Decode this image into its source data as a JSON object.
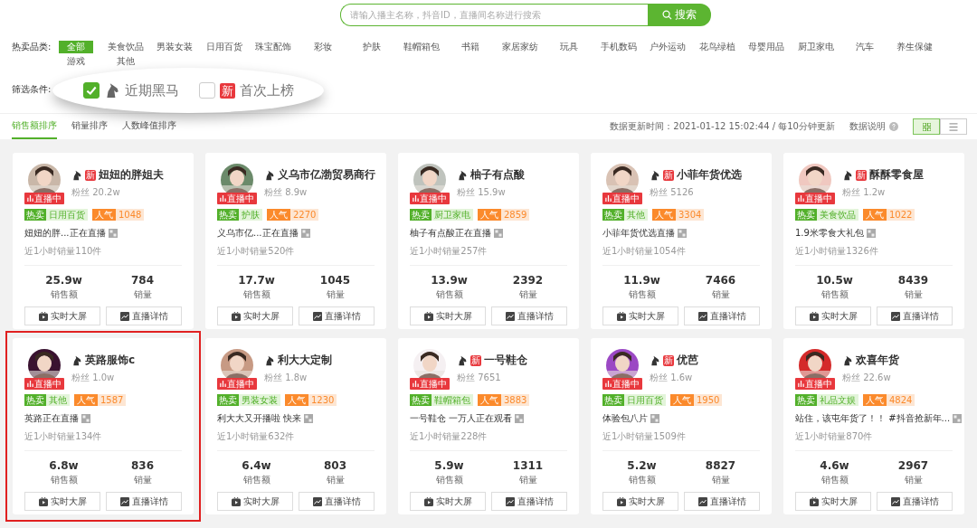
{
  "search": {
    "placeholder": "请输入播主名称，抖音ID，直播间名称进行搜索",
    "button": "搜索"
  },
  "categories": {
    "label": "热卖品类:",
    "items": [
      {
        "label": "全部",
        "selected": true
      },
      {
        "label": "美食饮品",
        "selected": false
      },
      {
        "label": "男装女装",
        "selected": false
      },
      {
        "label": "日用百货",
        "selected": false
      },
      {
        "label": "珠宝配饰",
        "selected": false
      },
      {
        "label": "彩妆",
        "selected": false
      },
      {
        "label": "护肤",
        "selected": false
      },
      {
        "label": "鞋帽箱包",
        "selected": false
      },
      {
        "label": "书籍",
        "selected": false
      },
      {
        "label": "家居家纺",
        "selected": false
      },
      {
        "label": "玩具",
        "selected": false
      },
      {
        "label": "手机数码",
        "selected": false
      },
      {
        "label": "户外运动",
        "selected": false
      },
      {
        "label": "花鸟绿植",
        "selected": false
      },
      {
        "label": "母婴用品",
        "selected": false
      },
      {
        "label": "厨卫家电",
        "selected": false
      },
      {
        "label": "汽车",
        "selected": false
      },
      {
        "label": "养生保健",
        "selected": false
      },
      {
        "label": "游戏",
        "selected": false
      },
      {
        "label": "其他",
        "selected": false
      }
    ]
  },
  "filters": {
    "label": "筛选条件:",
    "options": [
      {
        "kind": "dark_horse",
        "label": "近期黑马",
        "checked": true
      },
      {
        "kind": "new",
        "badge": "新",
        "label": "首次上榜",
        "checked": false
      }
    ]
  },
  "sort_tabs": [
    {
      "label": "销售额排序",
      "selected": true
    },
    {
      "label": "销量排序",
      "selected": false
    },
    {
      "label": "人数峰值排序",
      "selected": false
    }
  ],
  "update_time": "数据更新时间：2021-01-12 15:02:44 / 每10分钟更新",
  "help_label": "数据说明",
  "view_toggle": [
    {
      "kind": "grid",
      "selected": true
    },
    {
      "kind": "list",
      "selected": false
    }
  ],
  "cards": [
    {
      "name": "妞妞的胖姐夫",
      "new_badge": "新",
      "fans": "粉丝 20.2w",
      "live": "直播中",
      "hot": "热卖",
      "category": "日用百货",
      "pop_label": "人气",
      "popularity": "1048",
      "title": "妞妞的胖...正在直播",
      "recent": "近1小时销量110件",
      "amount": "25.9w",
      "amount_label": "销售额",
      "count": "784",
      "count_label": "销量",
      "buttons": [
        "实时大屏",
        "直播详情"
      ],
      "highlighted": false
    },
    {
      "name": "义乌市亿渤贸易商行",
      "fans": "粉丝 8.9w",
      "live": "直播中",
      "hot": "热卖",
      "category": "护肤",
      "pop_label": "人气",
      "popularity": "2270",
      "title": "义乌市亿...正在直播",
      "recent": "近1小时销量520件",
      "amount": "17.7w",
      "amount_label": "销售额",
      "count": "1045",
      "count_label": "销量",
      "buttons": [
        "实时大屏",
        "直播详情"
      ],
      "highlighted": false
    },
    {
      "name": "柚子有点酸",
      "fans": "粉丝 15.9w",
      "live": "直播中",
      "hot": "热卖",
      "category": "厨卫家电",
      "pop_label": "人气",
      "popularity": "2859",
      "title": "柚子有点酸正在直播",
      "recent": "近1小时销量257件",
      "amount": "13.9w",
      "amount_label": "销售额",
      "count": "2392",
      "count_label": "销量",
      "buttons": [
        "实时大屏",
        "直播详情"
      ],
      "highlighted": false
    },
    {
      "name": "小菲年货优选",
      "new_badge": "新",
      "fans": "粉丝 5126",
      "live": "直播中",
      "hot": "热卖",
      "category": "其他",
      "pop_label": "人气",
      "popularity": "3304",
      "title": "小菲年货优选直播",
      "recent": "近1小时销量1054件",
      "amount": "11.9w",
      "amount_label": "销售额",
      "count": "7466",
      "count_label": "销量",
      "buttons": [
        "实时大屏",
        "直播详情"
      ],
      "highlighted": false
    },
    {
      "name": "酥酥零食屋",
      "new_badge": "新",
      "fans": "粉丝 1.2w",
      "live": "直播中",
      "hot": "热卖",
      "category": "美食饮品",
      "pop_label": "人气",
      "popularity": "1022",
      "title": "1.9米零食大礼包",
      "recent": "近1小时销量1326件",
      "amount": "10.5w",
      "amount_label": "销售额",
      "count": "8439",
      "count_label": "销量",
      "buttons": [
        "实时大屏",
        "直播详情"
      ],
      "highlighted": false
    },
    {
      "name": "英路服饰c",
      "fans": "粉丝 1.0w",
      "live": "直播中",
      "hot": "热卖",
      "category": "其他",
      "pop_label": "人气",
      "popularity": "1587",
      "title": "英路正在直播",
      "recent": "近1小时销量134件",
      "amount": "6.8w",
      "amount_label": "销售额",
      "count": "836",
      "count_label": "销量",
      "buttons": [
        "实时大屏",
        "直播详情"
      ],
      "highlighted": true
    },
    {
      "name": "利大大定制",
      "fans": "粉丝 1.8w",
      "live": "直播中",
      "hot": "热卖",
      "category": "男装女装",
      "pop_label": "人气",
      "popularity": "1230",
      "title": "利大大又开播啦 快来",
      "recent": "近1小时销量632件",
      "amount": "6.4w",
      "amount_label": "销售额",
      "count": "803",
      "count_label": "销量",
      "buttons": [
        "实时大屏",
        "直播详情"
      ],
      "highlighted": false
    },
    {
      "name": "一号鞋仓",
      "new_badge": "新",
      "fans": "粉丝 7651",
      "live": "直播中",
      "hot": "热卖",
      "category": "鞋帽箱包",
      "pop_label": "人气",
      "popularity": "3883",
      "title": "一号鞋仓 一万人正在观看",
      "recent": "近1小时销量228件",
      "amount": "5.9w",
      "amount_label": "销售额",
      "count": "1311",
      "count_label": "销量",
      "buttons": [
        "实时大屏",
        "直播详情"
      ],
      "highlighted": false
    },
    {
      "name": "优芭",
      "new_badge": "新",
      "fans": "粉丝 1.6w",
      "live": "直播中",
      "hot": "热卖",
      "category": "日用百货",
      "pop_label": "人气",
      "popularity": "1950",
      "title": "体验包八片",
      "recent": "近1小时销量1509件",
      "amount": "5.2w",
      "amount_label": "销售额",
      "count": "8827",
      "count_label": "销量",
      "buttons": [
        "实时大屏",
        "直播详情"
      ],
      "highlighted": false
    },
    {
      "name": "欢喜年货",
      "fans": "粉丝 22.6w",
      "live": "直播中",
      "hot": "热卖",
      "category": "礼品文娱",
      "pop_label": "人气",
      "popularity": "4824",
      "title": "站住，该屯年货了！！ #抖音抢新年...",
      "recent": "近1小时销量870件",
      "amount": "4.6w",
      "amount_label": "销售额",
      "count": "2967",
      "count_label": "销量",
      "buttons": [
        "实时大屏",
        "直播详情"
      ],
      "highlighted": false
    }
  ]
}
